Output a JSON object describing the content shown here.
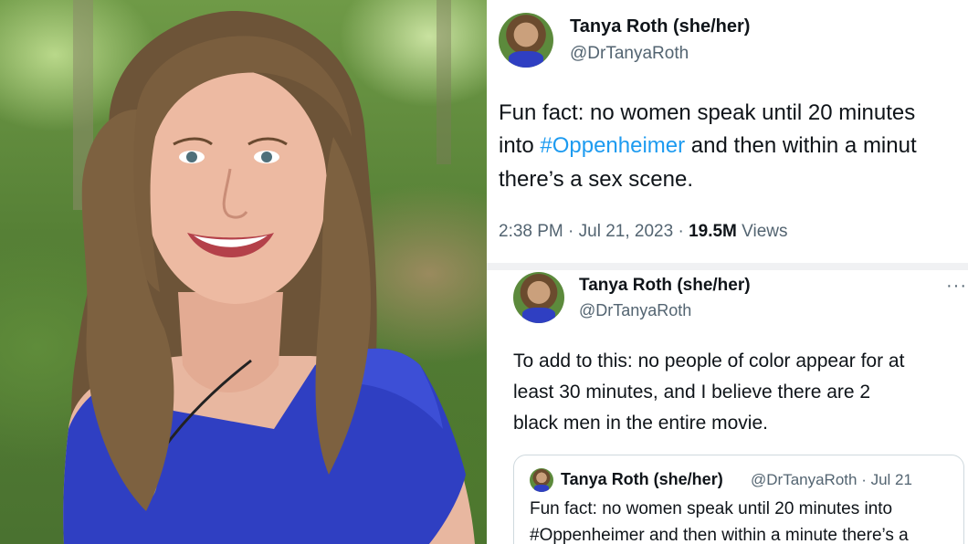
{
  "main_tweet": {
    "author_name": "Tanya Roth (she/her)",
    "handle": "@DrTanyaRoth",
    "text_line1": "Fun fact: no women speak until 20 minutes",
    "text_line2_pre": "into ",
    "text_line2_hashtag": "#Oppenheimer",
    "text_line2_post": " and then within a minut",
    "text_line3": "there’s a sex scene.",
    "timestamp": "2:38 PM · Jul 21, 2023 · ",
    "views_count": "19.5M",
    "views_label": " Views"
  },
  "reply_tweet": {
    "author_name": "Tanya Roth (she/her)",
    "handle": "@DrTanyaRoth",
    "more_label": "···",
    "text_line1": "To add to this: no people of color appear for at",
    "text_line2": "least 30 minutes, and I believe there are 2",
    "text_line3": "black men in the entire movie."
  },
  "quoted_tweet": {
    "author_name": "Tanya Roth (she/her)",
    "handle_date": "@DrTanyaRoth · Jul 21",
    "text_line1": "Fun fact: no women speak until 20 minutes into",
    "text_line2": "#Oppenheimer and then within a minute there’s a"
  },
  "colors": {
    "link": "#1d9bf0",
    "secondary_text": "#536471",
    "primary_text": "#0f1419",
    "dress": "#2f3fc2"
  }
}
